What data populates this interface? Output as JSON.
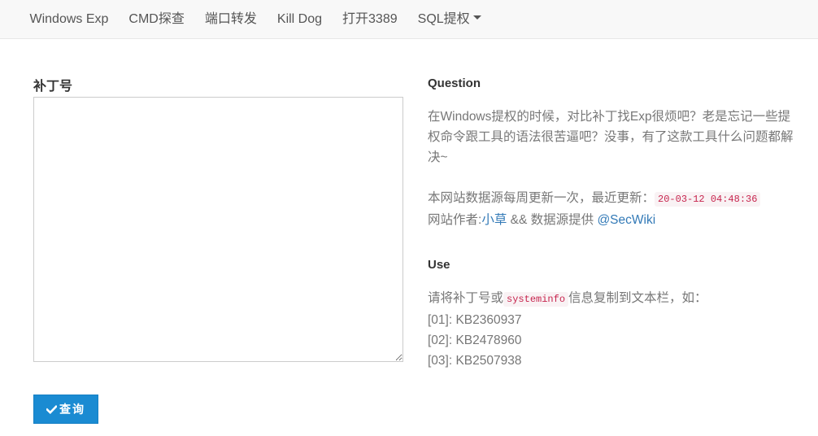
{
  "navbar": {
    "items": [
      {
        "label": "Windows Exp"
      },
      {
        "label": "CMD探查"
      },
      {
        "label": "端口转发"
      },
      {
        "label": "Kill Dog"
      },
      {
        "label": "打开3389"
      },
      {
        "label": "SQL提权"
      }
    ]
  },
  "form": {
    "label": "补丁号",
    "textarea_value": "",
    "submit_label": "查询",
    "submit_icon": "check-icon"
  },
  "question": {
    "title": "Question",
    "text": "在Windows提权的时候，对比补丁找Exp很烦吧？老是忘记一些提权命令跟工具的语法很苦逼吧？没事，有了这款工具什么问题都解决~",
    "update_prefix": "本网站数据源每周更新一次，最近更新：",
    "update_time": "20-03-12 04:48:36",
    "author_prefix": "网站作者:",
    "author_name": "小草",
    "author_mid": " && 数据源提供 ",
    "source_name": "@SecWiki"
  },
  "use": {
    "title": "Use",
    "instr_prefix": "请将补丁号或",
    "instr_code": "systeminfo",
    "instr_suffix": "信息复制到文本栏，如：",
    "examples": [
      "[01]: KB2360937",
      "[02]: KB2478960",
      "[03]: KB2507938"
    ]
  },
  "colors": {
    "accent": "#1a8bd2",
    "link": "#337ab7",
    "code": "#c7254e"
  }
}
